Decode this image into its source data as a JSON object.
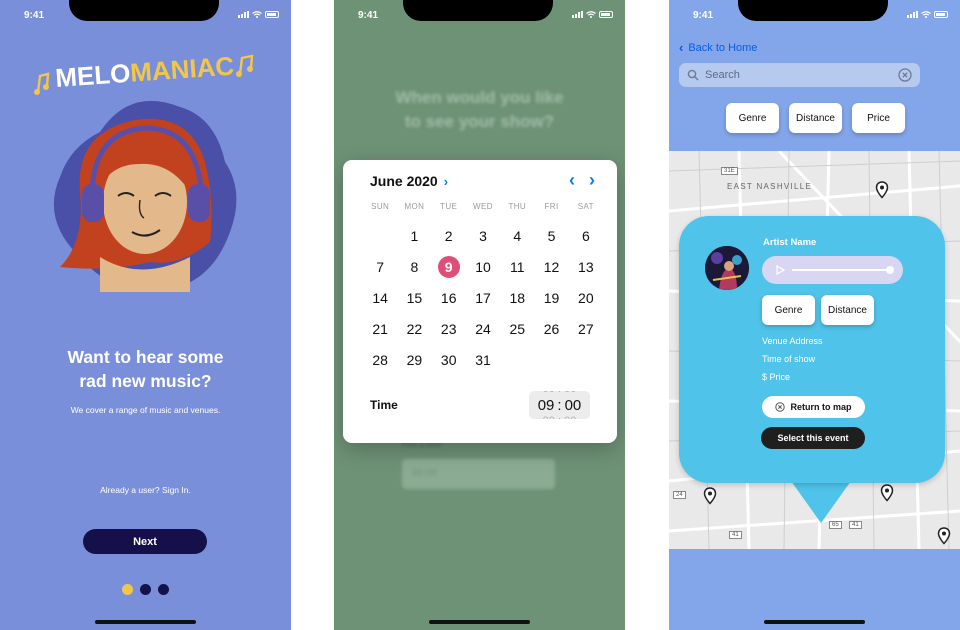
{
  "status_bar": {
    "time": "9:41"
  },
  "screen1": {
    "logo_text": "MELOMANIAC",
    "headline": "Want to  hear some\nrad new music?",
    "subtext": "We cover a range of music and venues.",
    "signin": "Already a user? Sign In.",
    "next_label": "Next",
    "pager": {
      "count": 3,
      "active_index": 0
    },
    "colors": {
      "background": "#7a8fd9",
      "accent": "#f2c649",
      "button": "#15104a"
    }
  },
  "screen2": {
    "question": "When would you like\nto see your show?",
    "pick_label": "Pick a time",
    "time_placeholder": "00:00",
    "calendar": {
      "month": "June 2020",
      "weekdays": [
        "SUN",
        "MON",
        "TUE",
        "WED",
        "THU",
        "FRI",
        "SAT"
      ],
      "first_weekday_index": 1,
      "days_in_month": 30,
      "weeks": [
        [
          "",
          "1",
          "2",
          "3",
          "4",
          "5",
          "6"
        ],
        [
          "7",
          "8",
          "9",
          "10",
          "11",
          "12",
          "13"
        ],
        [
          "14",
          "15",
          "16",
          "17",
          "18",
          "19",
          "20"
        ],
        [
          "21",
          "22",
          "23",
          "24",
          "25",
          "26",
          "27"
        ],
        [
          "28",
          "29",
          "30",
          "31",
          "",
          "",
          ""
        ]
      ],
      "selected_day": "9",
      "time_label": "Time",
      "time_hour": "09",
      "time_minute": "00"
    },
    "colors": {
      "background": "#6e9276",
      "selected": "#dd4f79",
      "link": "#0a7aff"
    }
  },
  "screen3": {
    "back_label": "Back to Home",
    "search_placeholder": "Search",
    "filters": [
      "Genre",
      "Distance",
      "Price"
    ],
    "map_labels": {
      "area": "EAST NASHVILLE",
      "route_1": "31E",
      "route_2": "41",
      "route_3": "24",
      "route_4": "41",
      "route_5": "65"
    },
    "event_card": {
      "artist": "Artist Name",
      "chips": [
        "Genre",
        "Distance"
      ],
      "venue": "Venue Address",
      "time": "Time of show",
      "price": "$ Price",
      "return_label": "Return to map",
      "select_label": "Select this event"
    },
    "colors": {
      "background": "#83a6ea",
      "card": "#4fc3e9",
      "link": "#0a5be0"
    }
  }
}
